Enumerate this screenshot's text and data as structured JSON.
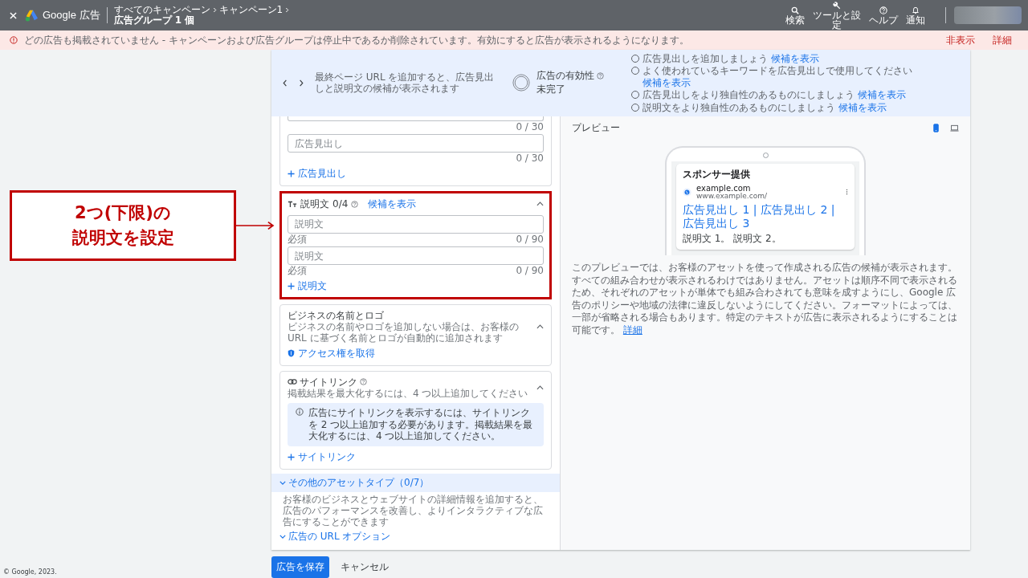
{
  "top_bar": {
    "product": "Google 広告",
    "breadcrumb": [
      "すべてのキャンペーン",
      "キャンペーン1"
    ],
    "current": "広告グループ 1 個",
    "actions": [
      {
        "label": "検索"
      },
      {
        "label": "ツールと設定"
      },
      {
        "label": "ヘルプ"
      },
      {
        "label": "通知"
      }
    ]
  },
  "alert": {
    "message": "どの広告も掲載されていません - キャンペーンおよび広告グループは停止中であるか削除されています。有効にすると広告が表示されるようになります。",
    "actions": [
      "非表示",
      "詳細"
    ]
  },
  "strength_bar": {
    "hint": "最終ページ URL を追加すると、広告見出しと説明文の候補が表示されます",
    "title": "広告の有効性",
    "status": "未完了",
    "suggestions": [
      {
        "text": "広告見出しを追加しましょう",
        "link": "候補を表示",
        "checked": false
      },
      {
        "text": "よく使われているキーワードを広告見出しで使用してください",
        "link": "候補を表示",
        "checked": false
      },
      {
        "text": "広告見出しをより独自性のあるものにしましょう",
        "link": "候補を表示",
        "checked": false
      },
      {
        "text": "説明文をより独自性のあるものにしましょう",
        "link": "候補を表示",
        "checked": false
      }
    ]
  },
  "headlines": {
    "fields": [
      {
        "counter": "0 / 30"
      },
      {
        "placeholder": "広告見出し",
        "counter": "0 / 30"
      }
    ],
    "add": "広告見出し"
  },
  "descriptions": {
    "title": "説明文",
    "count": "0/4",
    "link": "候補を表示",
    "highlighted": true,
    "expanded": true,
    "fields": [
      {
        "placeholder": "説明文",
        "helper": "必須",
        "counter": "0 / 90"
      },
      {
        "placeholder": "説明文",
        "helper": "必須",
        "counter": "0 / 90"
      }
    ],
    "add": "説明文"
  },
  "business": {
    "title": "ビジネスの名前とロゴ",
    "description": "ビジネスの名前やロゴを追加しない場合は、お客様の URL に基づく名前とロゴが自動的に追加されます",
    "expanded": true,
    "link": "アクセス権を取得"
  },
  "sitelinks": {
    "title": "サイトリンク",
    "description": "掲載結果を最大化するには、4 つ以上追加してください",
    "expanded": true,
    "info": "広告にサイトリンクを表示するには、サイトリンクを 2 つ以上追加する必要があります。掲載結果を最大化するには、4 つ以上追加してください。",
    "add": "サイトリンク"
  },
  "other_assets": {
    "title": "その他のアセットタイプ（0/7）",
    "expanded": false,
    "description": "お客様のビジネスとウェブサイトの詳細情報を追加すると、広告のパフォーマンスを改善し、よりインタラクティブな広告にすることができます"
  },
  "url_options": {
    "title": "広告の URL オプション",
    "expanded": false
  },
  "preview": {
    "title": "プレビュー",
    "devices": [
      {
        "selected": true
      },
      {
        "selected": false
      }
    ],
    "ad": {
      "label": "スポンサー提供",
      "domain": "example.com",
      "url": "www.example.com/",
      "headline": "広告見出し 1 | 広告見出し 2 | 広告見出し 3",
      "description": "説明文 1。 説明文 2。"
    },
    "note": "このプレビューでは、お客様のアセットを使って作成される広告の候補が表示されます。すべての組み合わせが表示されるわけではありません。アセットは順序不同で表示されるため、それぞれのアセットが単体でも組み合わされても意味を成すようにし、Google 広告のポリシーや地域の法律に違反しないようにしてください。フォーマットによっては、一部が省略される場合もあります。特定のテキストが広告に表示されるようにすることは可能です。",
    "note_link": "詳細"
  },
  "footer_buttons": [
    {
      "label": "広告を保存",
      "kind": "primary"
    },
    {
      "label": "キャンセル",
      "kind": "text"
    }
  ],
  "copyright": "© Google, 2023.",
  "annotation": {
    "lines": [
      "2つ(下限)の",
      "説明文を設定"
    ]
  }
}
